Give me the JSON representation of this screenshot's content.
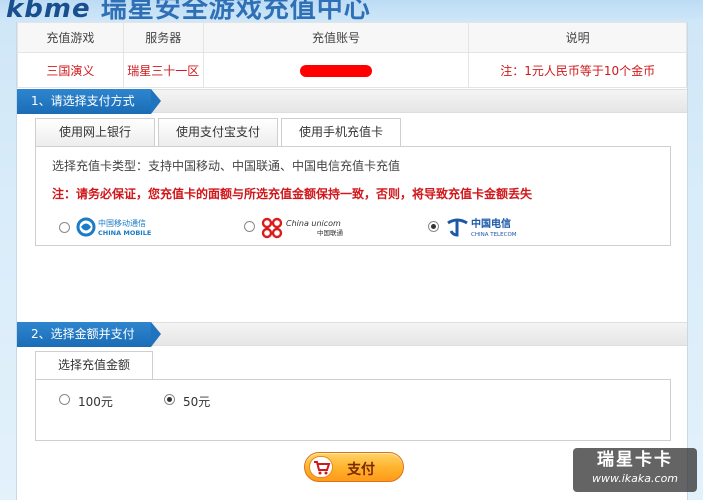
{
  "banner": {
    "brand": "kbme",
    "title": "瑞星安全游戏充值中心"
  },
  "info_table": {
    "headers": [
      "充值游戏",
      "服务器",
      "充值账号",
      "说明"
    ],
    "row": {
      "game": "三国演义",
      "server": "瑞星三十一区",
      "account": "",
      "note": "注：1元人民币等于10个金币"
    }
  },
  "section1": {
    "title": "1、请选择支付方式",
    "tabs": [
      {
        "label": "使用网上银行"
      },
      {
        "label": "使用支付宝支付"
      },
      {
        "label": "使用手机充值卡",
        "active": true
      }
    ],
    "hint": "选择充值卡类型：支持中国移动、中国联通、中国电信充值卡充值",
    "warning": "注：请务必保证，您充值卡的面额与所选充值金额保持一致，否则，将导致充值卡金额丢失",
    "carriers": [
      {
        "name": "中国移动通信",
        "sub": "CHINA MOBILE",
        "icon": "china-mobile-logo",
        "color": "#1a7bc6",
        "selected": false
      },
      {
        "name": "中国联通",
        "sub": "China unicom",
        "icon": "china-unicom-logo",
        "color": "#d91d1d",
        "selected": false
      },
      {
        "name": "中国电信",
        "sub": "CHINA TELECOM",
        "icon": "china-telecom-logo",
        "color": "#1b58a8",
        "selected": true
      }
    ]
  },
  "section2": {
    "title": "2、选择金额并支付",
    "tab": "选择充值金额",
    "amounts": [
      {
        "label": "100元",
        "selected": false
      },
      {
        "label": "50元",
        "selected": true
      }
    ]
  },
  "pay_button": {
    "label": "支付",
    "icon": "shopping-cart-icon"
  },
  "watermark": {
    "title": "瑞星卡卡",
    "url": "www.ikaka.com"
  },
  "colors": {
    "accent_blue": "#1f74bd",
    "warning_red": "#d0171b",
    "button_orange": "#ffb42e"
  }
}
